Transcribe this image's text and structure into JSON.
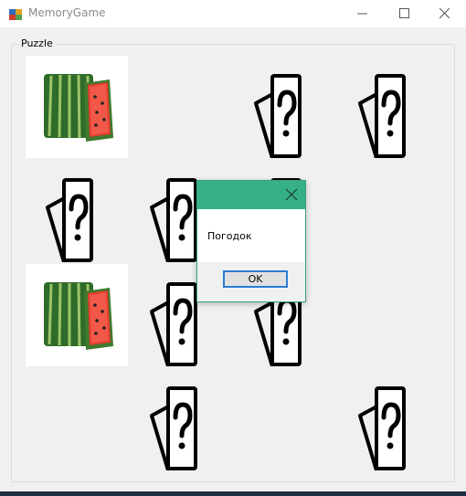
{
  "window": {
    "title": "MemoryGame"
  },
  "puzzle": {
    "label": "Puzzle",
    "tiles": [
      {
        "row": 1,
        "col": 1,
        "face": "watermelon"
      },
      {
        "row": 1,
        "col": 3,
        "face": "card-back"
      },
      {
        "row": 1,
        "col": 4,
        "face": "card-back"
      },
      {
        "row": 2,
        "col": 1,
        "face": "card-back"
      },
      {
        "row": 2,
        "col": 2,
        "face": "card-back"
      },
      {
        "row": 2,
        "col": 3,
        "face": "card-back"
      },
      {
        "row": 3,
        "col": 1,
        "face": "watermelon"
      },
      {
        "row": 3,
        "col": 2,
        "face": "card-back"
      },
      {
        "row": 3,
        "col": 3,
        "face": "card-back"
      },
      {
        "row": 4,
        "col": 2,
        "face": "card-back"
      },
      {
        "row": 4,
        "col": 4,
        "face": "card-back"
      }
    ]
  },
  "dialog": {
    "message": "Погодок",
    "ok_label": "OK"
  },
  "colors": {
    "dialog_title": "#35b089",
    "ok_border": "#2b7cd3"
  },
  "icons": [
    "app-icon",
    "minimize-icon",
    "maximize-icon",
    "close-icon",
    "question-card-icon",
    "watermelon-icon",
    "dialog-close-icon"
  ]
}
